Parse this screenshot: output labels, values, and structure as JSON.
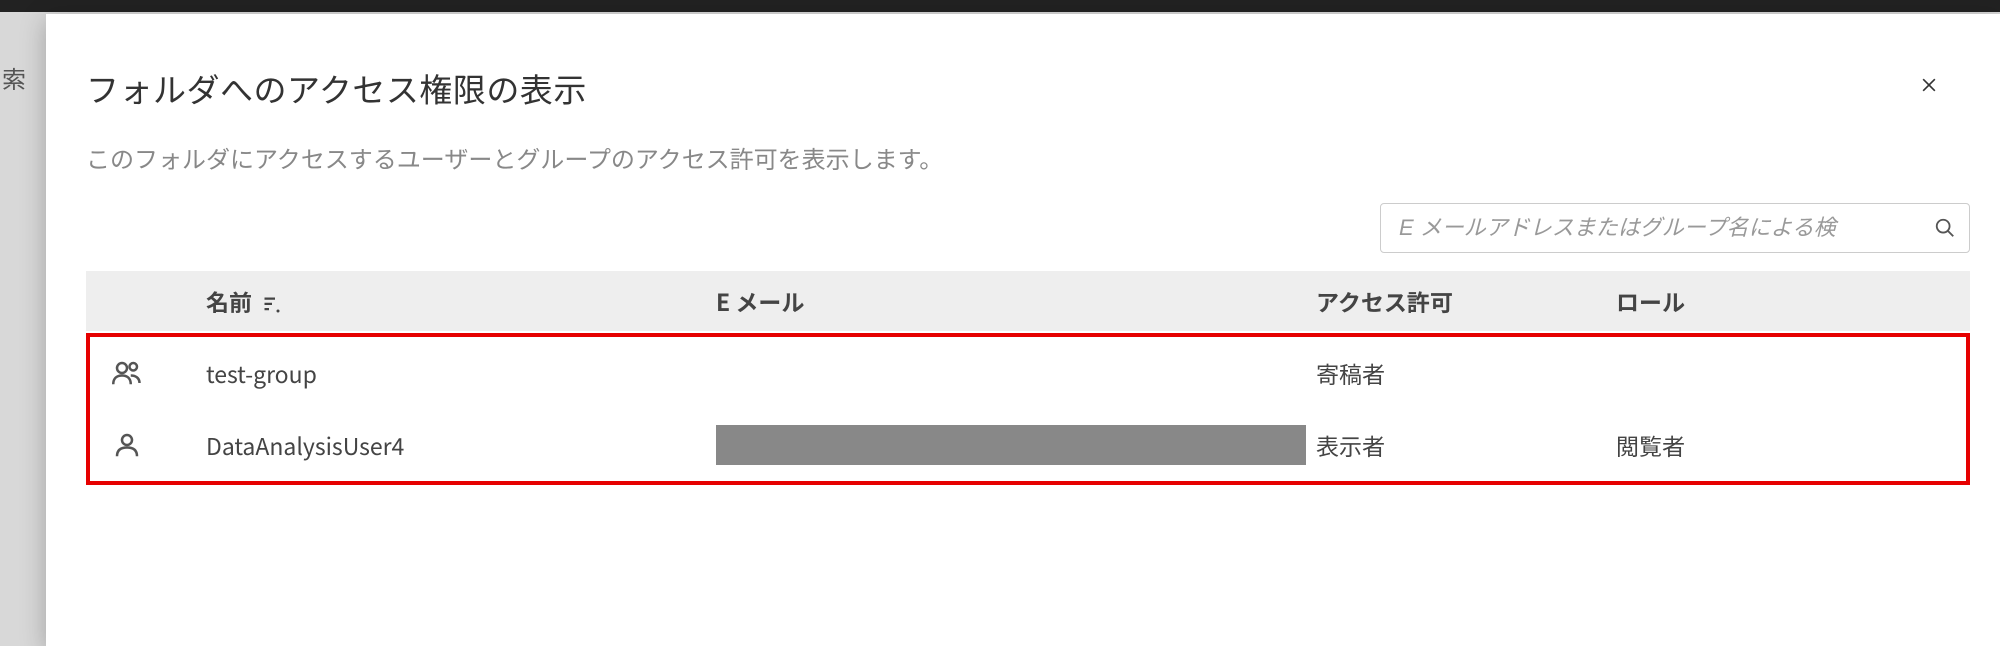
{
  "background": {
    "left_text_fragment": "索"
  },
  "modal": {
    "title": "フォルダへのアクセス権限の表示",
    "subtitle": "このフォルダにアクセスするユーザーとグループのアクセス許可を表示します。",
    "search": {
      "placeholder": "E メールアドレスまたはグループ名による検"
    },
    "table": {
      "columns": {
        "name": "名前",
        "email": "E メール",
        "permission": "アクセス許可",
        "role": "ロール"
      },
      "rows": [
        {
          "type": "group",
          "name": "test-group",
          "email": "",
          "email_redacted": false,
          "permission": "寄稿者",
          "role": ""
        },
        {
          "type": "user",
          "name": "DataAnalysisUser4",
          "email": "",
          "email_redacted": true,
          "permission": "表示者",
          "role": "閲覧者"
        }
      ]
    }
  }
}
